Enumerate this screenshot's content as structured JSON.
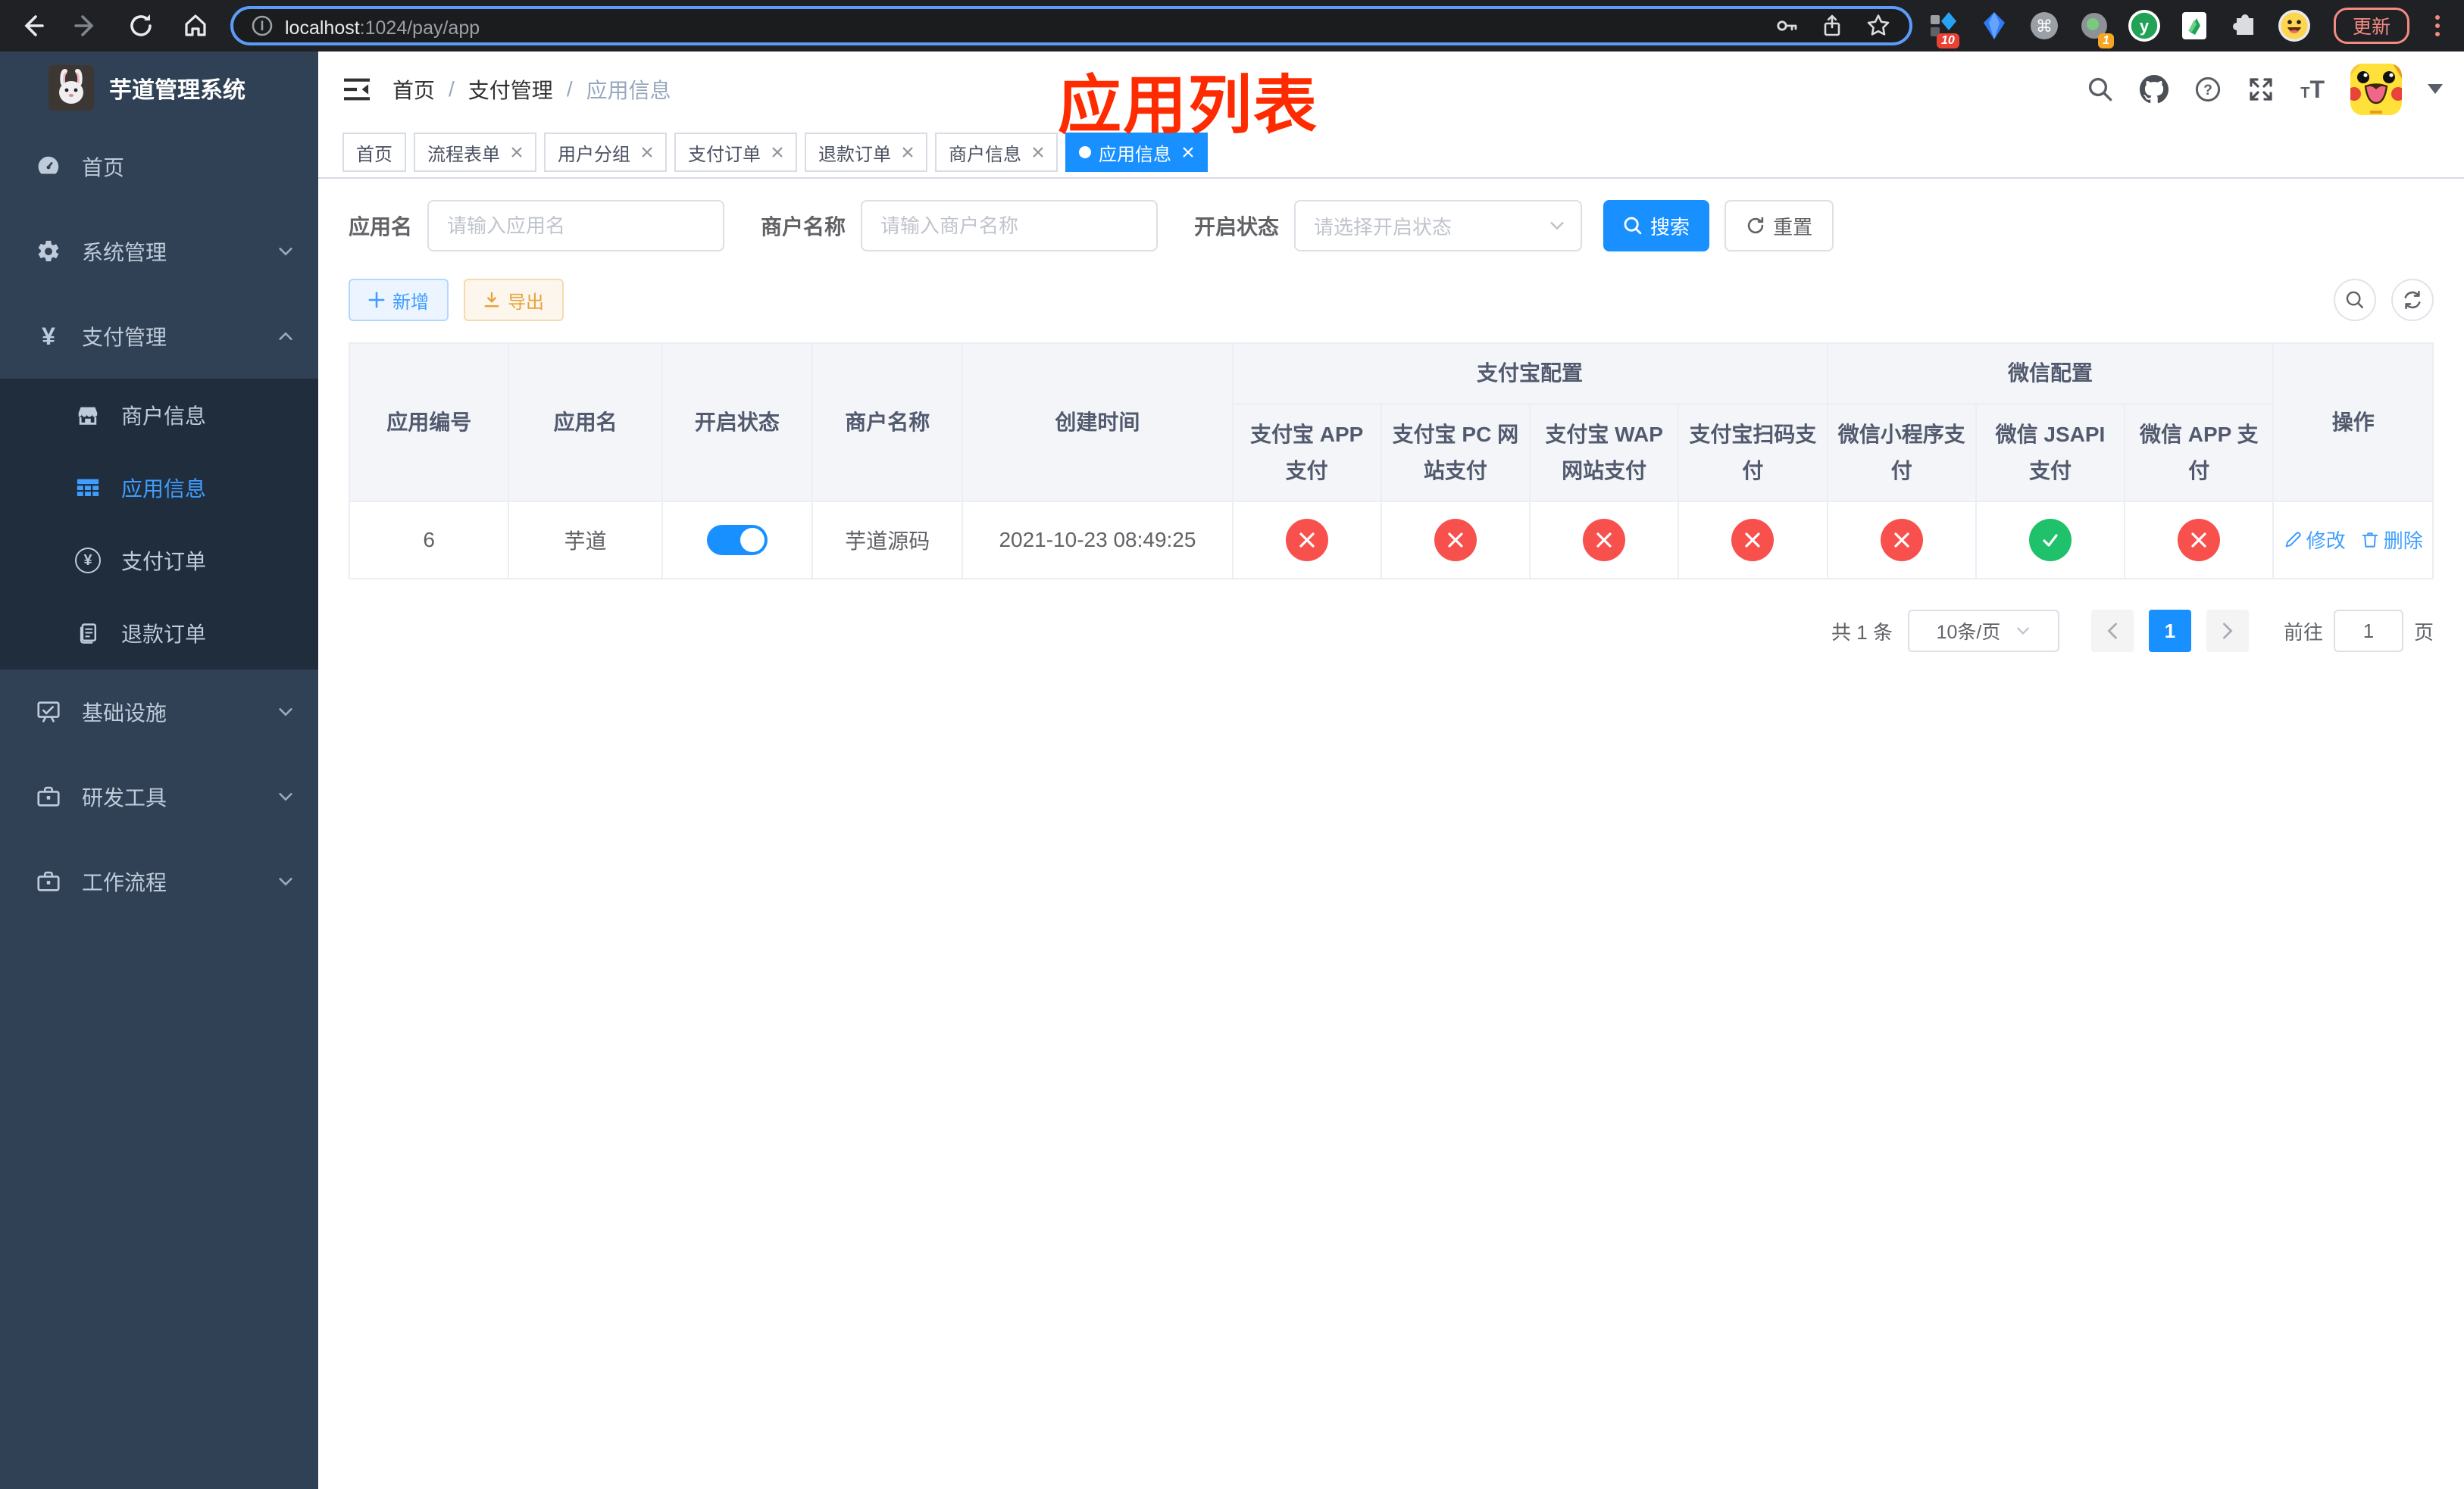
{
  "browser": {
    "url_host": "localhost",
    "url_rest": ":1024/pay/app",
    "update_label": "更新",
    "ext_badge_1": "10",
    "ext_badge_2": "1"
  },
  "sidebar": {
    "title": "芋道管理系统",
    "menu": {
      "home": "首页",
      "system": "系统管理",
      "payment": "支付管理",
      "merchant_info": "商户信息",
      "app_info": "应用信息",
      "pay_order": "支付订单",
      "refund_order": "退款订单",
      "infrastructure": "基础设施",
      "dev_tools": "研发工具",
      "workflow": "工作流程"
    }
  },
  "navbar": {
    "breadcrumb": [
      "首页",
      "支付管理",
      "应用信息"
    ]
  },
  "annotation": {
    "text": "应用列表",
    "color": "#ff2b00"
  },
  "tabs": [
    {
      "label": "首页",
      "closable": false,
      "active": false
    },
    {
      "label": "流程表单",
      "closable": true,
      "active": false
    },
    {
      "label": "用户分组",
      "closable": true,
      "active": false
    },
    {
      "label": "支付订单",
      "closable": true,
      "active": false
    },
    {
      "label": "退款订单",
      "closable": true,
      "active": false
    },
    {
      "label": "商户信息",
      "closable": true,
      "active": false
    },
    {
      "label": "应用信息",
      "closable": true,
      "active": true
    }
  ],
  "filters": {
    "app_name_label": "应用名",
    "app_name_placeholder": "请输入应用名",
    "merchant_label": "商户名称",
    "merchant_placeholder": "请输入商户名称",
    "status_label": "开启状态",
    "status_placeholder": "请选择开启状态",
    "search_label": "搜索",
    "reset_label": "重置"
  },
  "toolbar": {
    "add_label": "新增",
    "export_label": "导出"
  },
  "table": {
    "col_id": "应用编号",
    "col_name": "应用名",
    "col_status": "开启状态",
    "col_merchant": "商户名称",
    "col_created": "创建时间",
    "col_actions": "操作",
    "group_alipay": {
      "title": "支付宝配置",
      "cols": [
        "支付宝 APP 支付",
        "支付宝 PC 网站支付",
        "支付宝 WAP 网站支付",
        "支付宝扫码支付"
      ]
    },
    "group_wechat": {
      "title": "微信配置",
      "cols": [
        "微信小程序支付",
        "微信 JSAPI 支付",
        "微信 APP 支付"
      ]
    },
    "rows": [
      {
        "id": "6",
        "name": "芋道",
        "enabled": true,
        "merchant": "芋道源码",
        "created": "2021-10-23 08:49:25",
        "channels": {
          "alipay_app": false,
          "alipay_pc": false,
          "alipay_wap": false,
          "alipay_qr": false,
          "wx_lite": false,
          "wx_jsapi": true,
          "wx_app": false
        },
        "edit_label": "修改",
        "delete_label": "删除"
      }
    ]
  },
  "pagination": {
    "total": "共 1 条",
    "page_size": "10条/页",
    "page": "1",
    "goto_label": "前往",
    "goto_value": "1",
    "unit_label": "页"
  },
  "colors": {
    "accent_blue": "#1890ff",
    "sidebar_bg": "#304156",
    "submenu_bg": "#1f2d3d",
    "menu_active": "#409eff",
    "success_green": "#1fc16b",
    "danger_red": "#f8514d",
    "annotation_red": "#ff2b00"
  }
}
